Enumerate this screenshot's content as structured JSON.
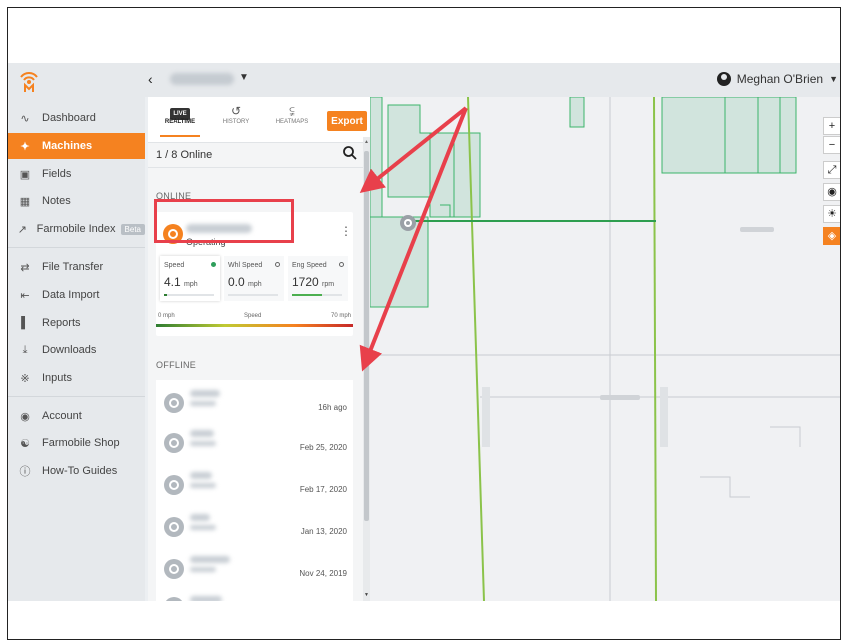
{
  "topbar": {
    "farm_name": "South Farms",
    "user_name": "Meghan O'Brien"
  },
  "sidebar": {
    "items": [
      {
        "label": "Dashboard",
        "icon": "dashboard-icon"
      },
      {
        "label": "Machines",
        "icon": "machines-icon",
        "active": true
      },
      {
        "label": "Fields",
        "icon": "fields-icon"
      },
      {
        "label": "Notes",
        "icon": "notes-icon"
      },
      {
        "label": "Farmobile Index",
        "icon": "index-icon",
        "badge": "Beta"
      },
      {
        "label": "File Transfer",
        "icon": "file-transfer-icon"
      },
      {
        "label": "Data Import",
        "icon": "data-import-icon"
      },
      {
        "label": "Reports",
        "icon": "reports-icon"
      },
      {
        "label": "Downloads",
        "icon": "downloads-icon"
      },
      {
        "label": "Inputs",
        "icon": "inputs-icon"
      },
      {
        "label": "Account",
        "icon": "account-icon"
      },
      {
        "label": "Farmobile Shop",
        "icon": "shop-icon"
      },
      {
        "label": "How-To Guides",
        "icon": "help-icon"
      }
    ]
  },
  "panel": {
    "tabs": [
      {
        "label": "REALTIME",
        "badge": "LIVE",
        "active": true
      },
      {
        "label": "HISTORY"
      },
      {
        "label": "HEATMAPS"
      }
    ],
    "export_label": "Export",
    "online_count": "1 / 8 Online",
    "online_header": "ONLINE",
    "offline_header": "OFFLINE",
    "active_machine": {
      "status": "Operating",
      "metrics": [
        {
          "label": "Speed",
          "value": "4.1",
          "unit": "mph",
          "status_color": "#2e9e5b",
          "level": 0.06
        },
        {
          "label": "Whl Speed",
          "value": "0.0",
          "unit": "mph",
          "status_color": "#ffffff",
          "level": 0.0
        },
        {
          "label": "Eng Speed",
          "value": "1720",
          "unit": "rpm",
          "status_color": "#ffffff",
          "level": 0.6
        }
      ],
      "speed_scale": {
        "min": "0 mph",
        "label": "Speed",
        "max": "70 mph"
      }
    },
    "offline_machines": [
      {
        "date": "16h ago"
      },
      {
        "date": "Feb 25, 2020"
      },
      {
        "date": "Feb 17, 2020"
      },
      {
        "date": "Jan 13, 2020"
      },
      {
        "date": "Nov 24, 2019"
      },
      {
        "date": ""
      }
    ]
  },
  "colors": {
    "accent": "#f58220",
    "annotation": "#e8404b",
    "field_green": "#3bb56a",
    "road_green": "#8bc34a"
  }
}
